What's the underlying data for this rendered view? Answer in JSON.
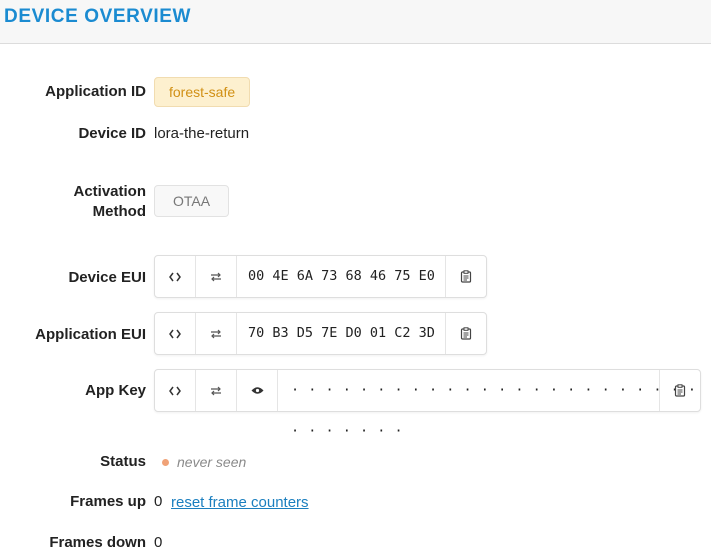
{
  "header": {
    "title": "DEVICE OVERVIEW"
  },
  "fields": {
    "application_id": {
      "label": "Application ID",
      "value": "forest-safe"
    },
    "device_id": {
      "label": "Device ID",
      "value": "lora-the-return"
    },
    "activation_method": {
      "label_line1": "Activation",
      "label_line2": "Method",
      "value": "OTAA"
    },
    "device_eui": {
      "label": "Device EUI",
      "value": "00 4E 6A 73 68 46 75 E0"
    },
    "application_eui": {
      "label": "Application EUI",
      "value": "70 B3 D5 7E D0 01 C2 3D"
    },
    "app_key": {
      "label": "App Key",
      "value": "· · · · · · · · · · · · · · · · · · · · · · · · · · · · · · ·"
    },
    "status": {
      "label": "Status",
      "value": "never seen",
      "dot_color": "#f0a277"
    },
    "frames_up": {
      "label": "Frames up",
      "value": "0",
      "link": "reset frame counters"
    },
    "frames_down": {
      "label": "Frames down",
      "value": "0"
    }
  },
  "icons": {
    "toggle_format": "code-brackets-icon",
    "byte_order": "swap-arrows-icon",
    "visibility": "eye-icon",
    "copy": "clipboard-icon"
  },
  "colors": {
    "accent": "#1b8bd1",
    "badge_bg": "#fdf0cf",
    "badge_text": "#d19015",
    "link": "#1b7fbf"
  }
}
